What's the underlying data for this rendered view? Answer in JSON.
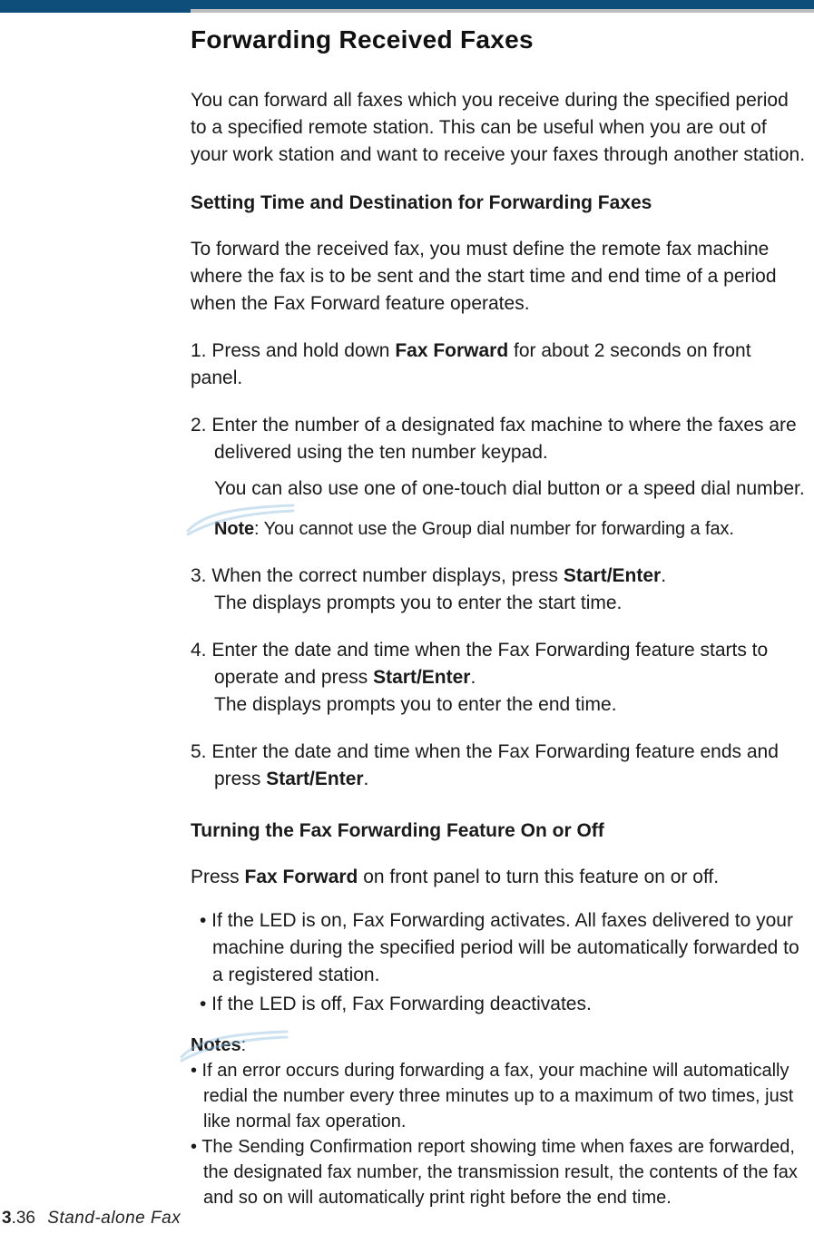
{
  "title": "Forwarding Received Faxes",
  "intro": "You can forward all faxes which you receive during the specified period to a specified remote station. This can be useful when you are out of your work station and want to receive your faxes through another station.",
  "section1": {
    "heading": "Setting Time and Destination for Forwarding Faxes",
    "intro": "To forward the received fax, you must define the remote fax machine where the fax is to be sent and the start time and end time of a period when the Fax Forward feature operates.",
    "step1_pre": "1. Press and hold down ",
    "step1_bold": "Fax Forward",
    "step1_post": " for about 2 seconds on front panel.",
    "step2": "2. Enter the number of a designated fax machine to where the faxes are",
    "step2_line2": "delivered using the ten number keypad.",
    "step2_sub": "You can also use one of one-touch dial button or a speed dial number.",
    "step2_note_label": "Note",
    "step2_note_text": ": You cannot use the Group dial number for forwarding a fax.",
    "step3_pre": "3. When the correct number displays, press ",
    "step3_bold": "Start/Enter",
    "step3_post": ".",
    "step3_line2": "The displays prompts you to enter the start time.",
    "step4_pre": "4. Enter the date and time when the Fax Forwarding feature starts to",
    "step4_line2_pre": "operate and press ",
    "step4_line2_bold": "Start/Enter",
    "step4_line2_post": ".",
    "step4_line3": "The displays prompts you to enter the end time.",
    "step5_pre": "5. Enter the date and time when the Fax Forwarding feature ends and",
    "step5_line2_pre": "press ",
    "step5_line2_bold": "Start/Enter",
    "step5_line2_post": "."
  },
  "section2": {
    "heading": "Turning the Fax Forwarding Feature On or Off",
    "intro_pre": "Press ",
    "intro_bold": "Fax Forward",
    "intro_post": " on front panel to turn this feature on or off.",
    "bullet1": "• If the LED is on, Fax Forwarding activates. All faxes delivered to your machine during the specified period will be automatically forwarded to a registered station.",
    "bullet2": "• If the LED is off, Fax Forwarding deactivates.",
    "notes_label": "Notes",
    "notes_colon": ":",
    "note1": "• If an error occurs during forwarding a fax, your machine will automatically redial the number every three minutes up to a maximum of two times, just like normal fax operation.",
    "note2": "• The Sending Confirmation report showing time when faxes are forwarded, the designated fax number, the transmission result, the contents of the fax and so on will automatically print right before the end time."
  },
  "footer": {
    "chapter": "3",
    "page": ".36",
    "book": "Stand-alone Fax"
  }
}
